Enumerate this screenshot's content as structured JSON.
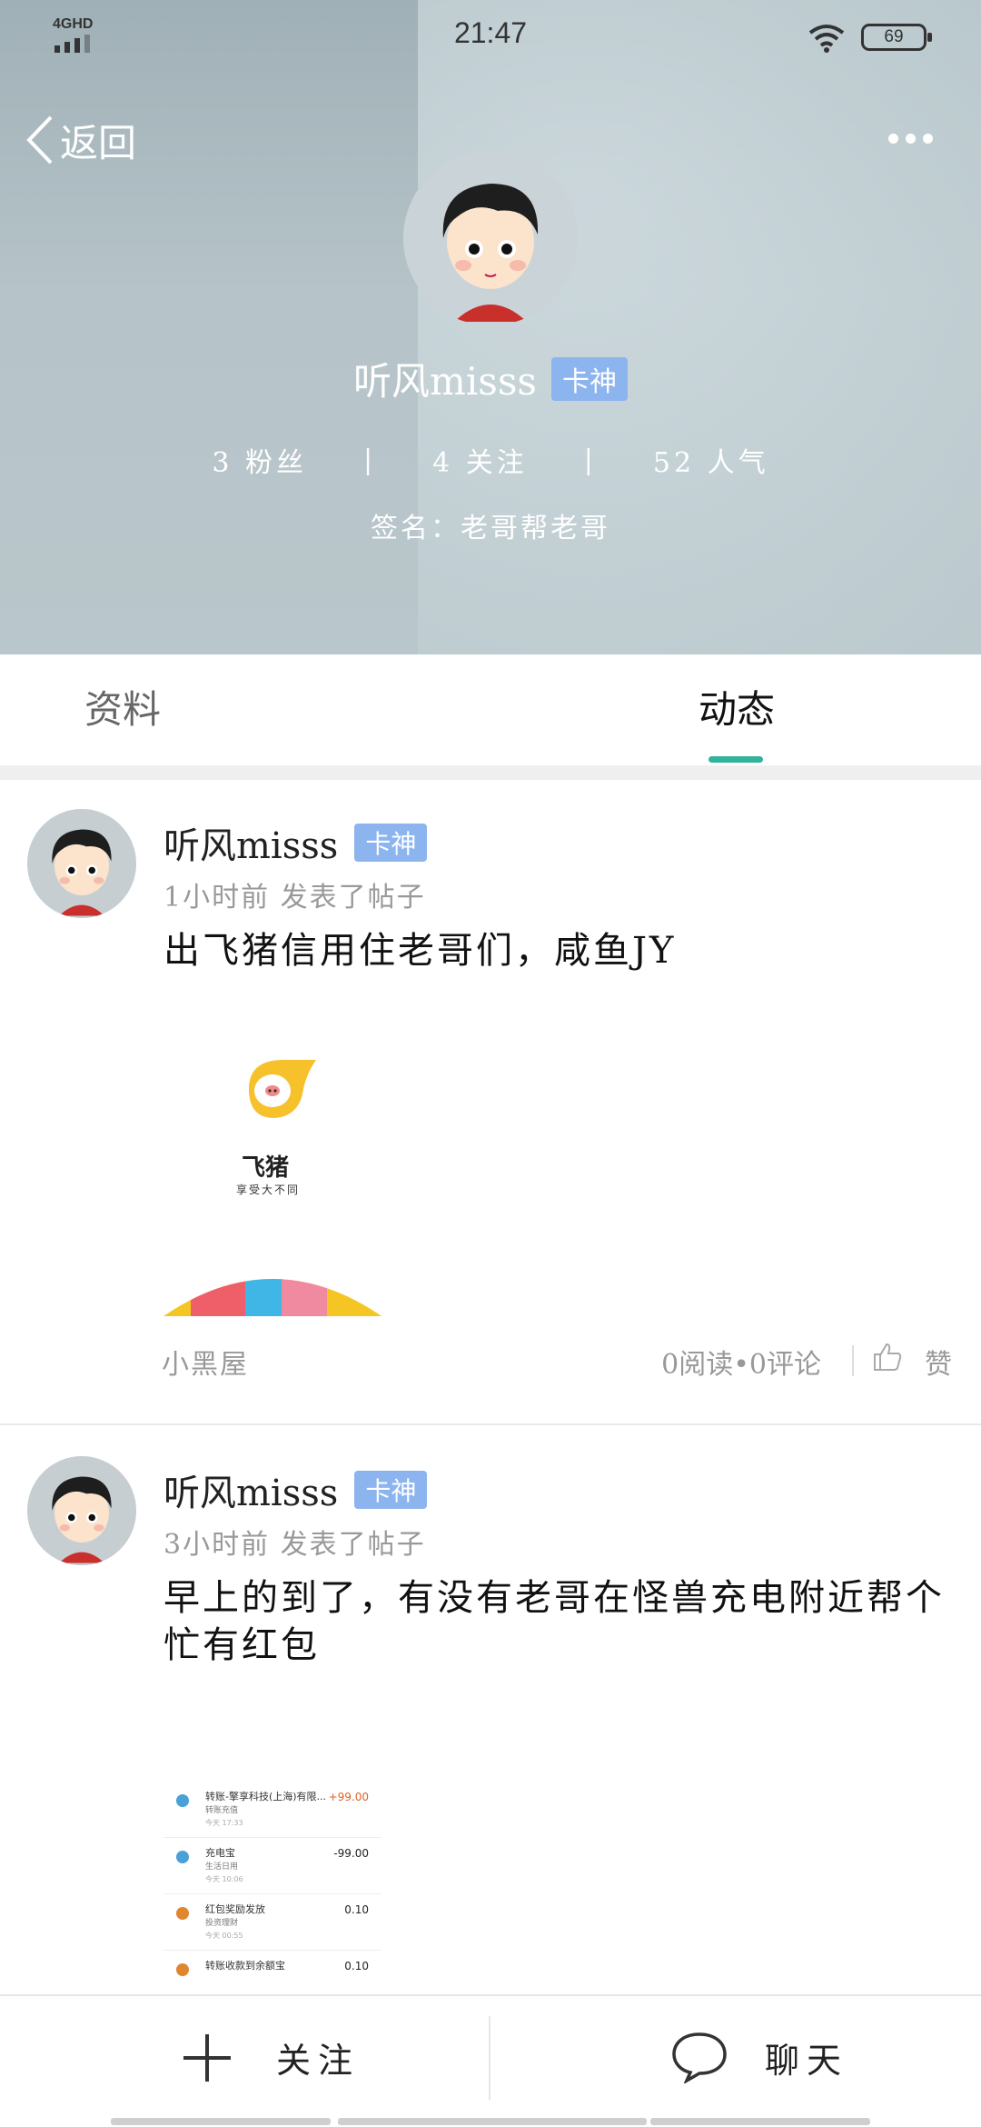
{
  "status_bar": {
    "network": "4GHD",
    "time": "21:47",
    "battery": "69"
  },
  "header": {
    "back_label": "返回",
    "user_name": "听风misss",
    "badge": "卡神",
    "stats": {
      "fans": "3 粉丝",
      "following": "4 关注",
      "popularity": "52 人气",
      "separator": "|"
    },
    "signature": "签名：老哥帮老哥"
  },
  "tabs": {
    "info": "资料",
    "feed": "动态",
    "active": "feed",
    "accent_color": "#2fb39a"
  },
  "posts": [
    {
      "user_name": "听风misss",
      "badge": "卡神",
      "time": "1小时前 发表了帖子",
      "text": "出飞猪信用住老哥们，咸鱼JY",
      "image": {
        "brand": "飞猪",
        "slogan": "享受大不同"
      },
      "group": "小黑屋",
      "stats": "0阅读•0评论",
      "like_label": "赞"
    },
    {
      "user_name": "听风misss",
      "badge": "卡神",
      "time": "3小时前 发表了帖子",
      "text": "早上的到了，有没有老哥在怪兽充电附近帮个忙有红包",
      "image": {
        "transactions": [
          {
            "title": "转账-擎享科技(上海)有限...",
            "sub": "转账充值",
            "date": "今天 17:33",
            "amount": "+99.00"
          },
          {
            "title": "充电宝",
            "sub": "生活日用",
            "date": "今天 10:06",
            "amount": "-99.00"
          },
          {
            "title": "红包奖励发放",
            "sub": "投资理财",
            "date": "今天 00:55",
            "amount": "0.10"
          },
          {
            "title": "转账收款到余额宝",
            "sub": "",
            "date": "",
            "amount": "0.10"
          }
        ]
      }
    }
  ],
  "bottom_bar": {
    "follow_label": "关注",
    "chat_label": "聊天"
  },
  "colors": {
    "badge": "#8cb4ef",
    "accent": "#2fb39a"
  }
}
